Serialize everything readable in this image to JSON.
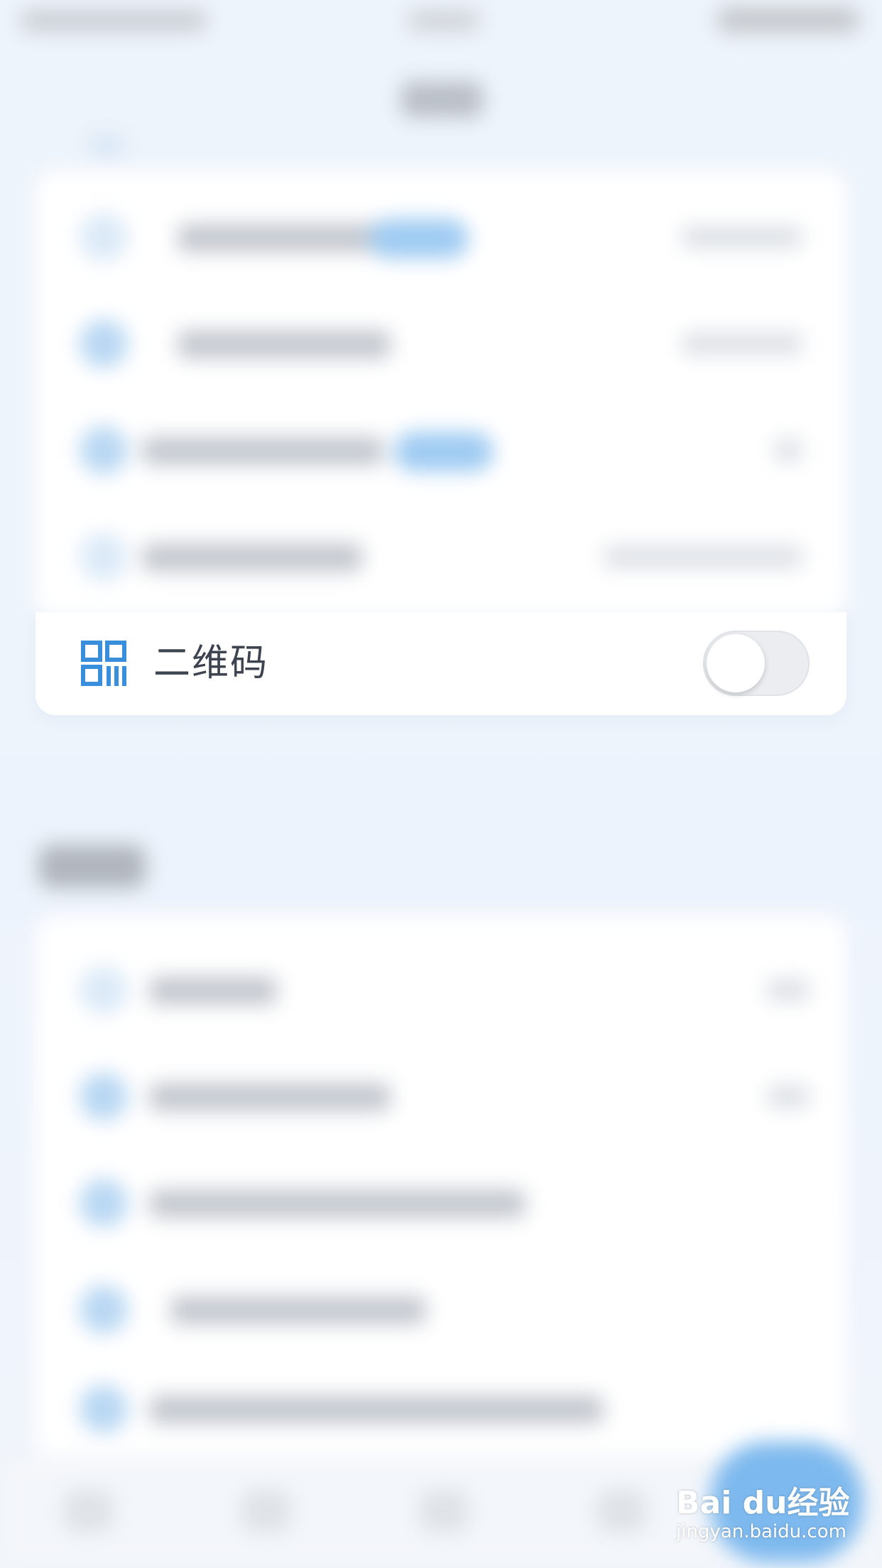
{
  "qr_setting": {
    "icon": "qr-code-icon",
    "label": "二维码",
    "toggle": {
      "on": false
    }
  },
  "watermark": {
    "brand": "Bai du经验",
    "url": "jingyan.baidu.com"
  },
  "colors": {
    "accent": "#3a8fdc",
    "label": "#3d4450",
    "toggle_off": "#ebedf0"
  }
}
